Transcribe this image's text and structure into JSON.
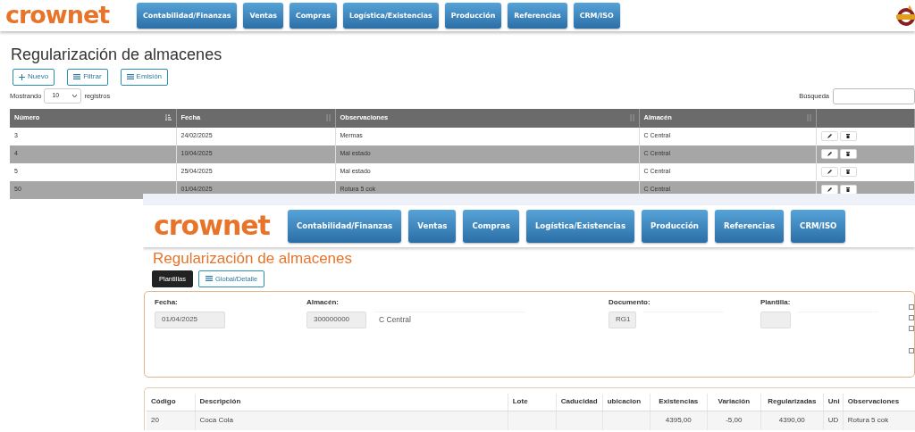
{
  "list_page": {
    "brand": "crownet",
    "nav": [
      "Contabilidad/Finanzas",
      "Ventas",
      "Compras",
      "Logística/Existencias",
      "Producción",
      "Referencias",
      "CRM/ISO"
    ],
    "title": "Regularización de almacenes",
    "actions": [
      {
        "label": "Nuevo"
      },
      {
        "label": "Filtrar"
      },
      {
        "label": "Emisión"
      }
    ],
    "length": {
      "prefix": "Mostrando",
      "value": "10",
      "suffix": "registros"
    },
    "search": {
      "label": "Búsqueda"
    },
    "table": {
      "columns": [
        {
          "label": "Número"
        },
        {
          "label": "Fecha"
        },
        {
          "label": "Observaciones"
        },
        {
          "label": "Almacén"
        }
      ],
      "rows": [
        {
          "cells": [
            "3",
            "24/02/2025",
            "Mermas",
            "C Central"
          ]
        },
        {
          "cells": [
            "4",
            "10/04/2025",
            "Mal estado",
            "C Central"
          ]
        },
        {
          "cells": [
            "5",
            "25/04/2025",
            "Mal estado",
            "C Central"
          ]
        },
        {
          "cells": [
            "50",
            "01/04/2025",
            "Rotura 5 cok",
            "C Central"
          ]
        }
      ]
    }
  },
  "detail_page": {
    "brand": "crownet",
    "nav": [
      "Contabilidad/Finanzas",
      "Ventas",
      "Compras",
      "Logística/Existencias",
      "Producción",
      "Referencias",
      "CRM/ISO"
    ],
    "title": "Regularización de almacenes",
    "buttons": [
      {
        "label": "Plantillas",
        "kind": "dark"
      },
      {
        "label": "Global/Detalle",
        "kind": "outline"
      }
    ],
    "fields": [
      {
        "label": "Fecha:",
        "value": "01/04/2025",
        "extra": false
      },
      {
        "label": "Almacén:",
        "value": "300000000",
        "extra": true,
        "extra_value": "C Central"
      },
      {
        "label": "Documento:",
        "value": "RG1",
        "extra": true
      },
      {
        "label": "Plantilla:",
        "extra": true
      }
    ],
    "checkboxes": [
      {
        "checked": false
      },
      {
        "checked": false
      },
      {
        "checked": false
      },
      {
        "checked": false
      }
    ],
    "lines": {
      "columns": [
        "Código",
        "Descripción",
        "Lote",
        "Caducidad",
        "ubicacion",
        "Existencias",
        "Variación",
        "Regularizadas",
        "Uni",
        "Observaciones"
      ],
      "rows": [
        {
          "cells": [
            "20",
            "Coca Cola",
            null,
            null,
            null,
            "4395,00",
            "-5,00",
            "4390,00",
            "UD",
            "Rotura 5 cok"
          ]
        }
      ]
    }
  }
}
